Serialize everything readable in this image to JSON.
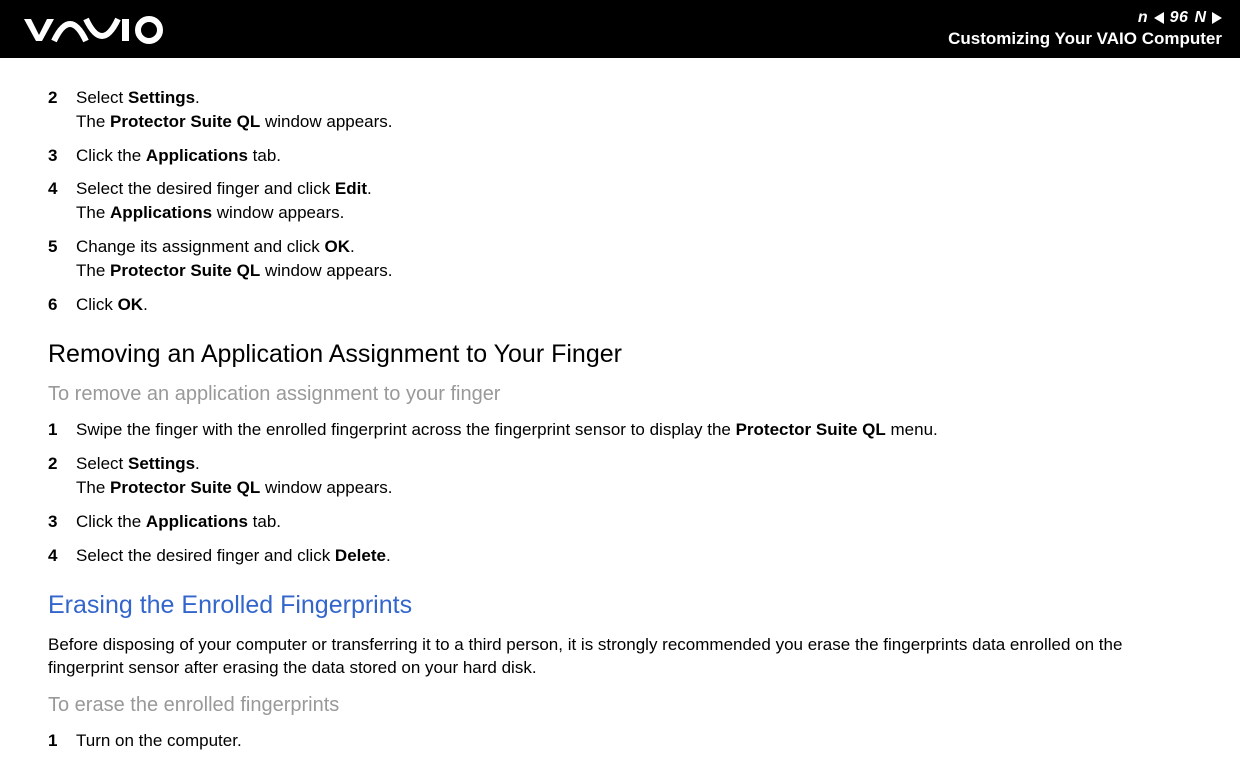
{
  "header": {
    "page_number": "96",
    "nav_label_n": "n",
    "nav_label_N": "N",
    "title": "Customizing Your VAIO Computer"
  },
  "steps_top": [
    {
      "num": "2",
      "parts": [
        {
          "t": "Select ",
          "b": false
        },
        {
          "t": "Settings",
          "b": true
        },
        {
          "t": ".",
          "b": false
        }
      ],
      "line2_parts": [
        {
          "t": "The ",
          "b": false
        },
        {
          "t": "Protector Suite QL",
          "b": true
        },
        {
          "t": " window appears.",
          "b": false
        }
      ]
    },
    {
      "num": "3",
      "parts": [
        {
          "t": "Click the ",
          "b": false
        },
        {
          "t": "Applications",
          "b": true
        },
        {
          "t": " tab.",
          "b": false
        }
      ]
    },
    {
      "num": "4",
      "parts": [
        {
          "t": "Select the desired finger and click ",
          "b": false
        },
        {
          "t": "Edit",
          "b": true
        },
        {
          "t": ".",
          "b": false
        }
      ],
      "line2_parts": [
        {
          "t": "The ",
          "b": false
        },
        {
          "t": "Applications",
          "b": true
        },
        {
          "t": " window appears.",
          "b": false
        }
      ]
    },
    {
      "num": "5",
      "parts": [
        {
          "t": "Change its assignment and click ",
          "b": false
        },
        {
          "t": "OK",
          "b": true
        },
        {
          "t": ".",
          "b": false
        }
      ],
      "line2_parts": [
        {
          "t": "The ",
          "b": false
        },
        {
          "t": "Protector Suite QL",
          "b": true
        },
        {
          "t": " window appears.",
          "b": false
        }
      ]
    },
    {
      "num": "6",
      "parts": [
        {
          "t": "Click ",
          "b": false
        },
        {
          "t": "OK",
          "b": true
        },
        {
          "t": ".",
          "b": false
        }
      ]
    }
  ],
  "heading_remove": "Removing an Application Assignment to Your Finger",
  "subheading_remove": "To remove an application assignment to your finger",
  "steps_remove": [
    {
      "num": "1",
      "parts": [
        {
          "t": "Swipe the finger with the enrolled fingerprint across the fingerprint sensor to display the ",
          "b": false
        },
        {
          "t": "Protector Suite QL",
          "b": true
        },
        {
          "t": " menu.",
          "b": false
        }
      ]
    },
    {
      "num": "2",
      "parts": [
        {
          "t": "Select ",
          "b": false
        },
        {
          "t": "Settings",
          "b": true
        },
        {
          "t": ".",
          "b": false
        }
      ],
      "line2_parts": [
        {
          "t": "The ",
          "b": false
        },
        {
          "t": "Protector Suite QL",
          "b": true
        },
        {
          "t": " window appears.",
          "b": false
        }
      ]
    },
    {
      "num": "3",
      "parts": [
        {
          "t": "Click the ",
          "b": false
        },
        {
          "t": "Applications",
          "b": true
        },
        {
          "t": " tab.",
          "b": false
        }
      ]
    },
    {
      "num": "4",
      "parts": [
        {
          "t": "Select the desired finger and click ",
          "b": false
        },
        {
          "t": "Delete",
          "b": true
        },
        {
          "t": ".",
          "b": false
        }
      ]
    }
  ],
  "heading_erase": "Erasing the Enrolled Fingerprints",
  "erase_body": "Before disposing of your computer or transferring it to a third person, it is strongly recommended you erase the fingerprints data enrolled on the fingerprint sensor after erasing the data stored on your hard disk.",
  "subheading_erase": "To erase the enrolled fingerprints",
  "steps_erase": [
    {
      "num": "1",
      "parts": [
        {
          "t": "Turn on the computer.",
          "b": false
        }
      ]
    }
  ]
}
